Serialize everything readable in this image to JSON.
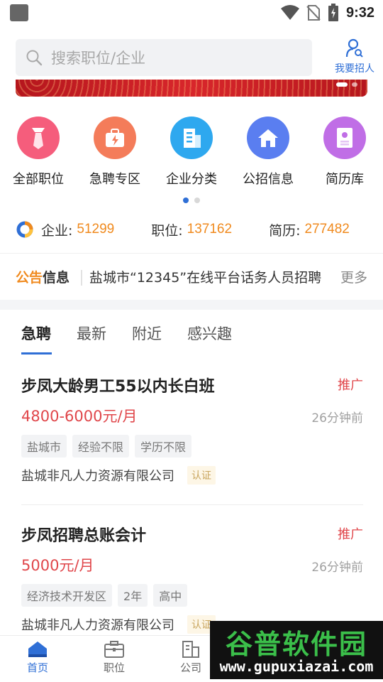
{
  "status_bar": {
    "time": "9:32"
  },
  "header": {
    "search_placeholder": "搜索职位/企业",
    "recruit_label": "我要招人"
  },
  "categories": [
    {
      "label": "全部职位",
      "icon": "tie-icon",
      "color": "#f55d7c"
    },
    {
      "label": "急聘专区",
      "icon": "urgent-bag-icon",
      "color": "#f47c5a"
    },
    {
      "label": "企业分类",
      "icon": "building-icon",
      "color": "#2ea8ef"
    },
    {
      "label": "公招信息",
      "icon": "home-icon",
      "color": "#5a7ef0"
    },
    {
      "label": "简历库",
      "icon": "resume-icon",
      "color": "#c06ee6"
    }
  ],
  "stats": {
    "company_label": "企业:",
    "company_count": "51299",
    "position_label": "职位:",
    "position_count": "137162",
    "resume_label": "简历:",
    "resume_count": "277482"
  },
  "notice": {
    "logo_a": "公告",
    "logo_b": "信息",
    "text": "盐城市“12345”在线平台话务人员招聘",
    "more": "更多"
  },
  "tabs": [
    "急聘",
    "最新",
    "附近",
    "感兴趣"
  ],
  "jobs": [
    {
      "title": "步凤大龄男工55以内长白班",
      "promo": "推广",
      "salary": "4800-6000元/月",
      "time": "26分钟前",
      "tags": [
        "盐城市",
        "经验不限",
        "学历不限"
      ],
      "company": "盐城非凡人力资源有限公司",
      "cert": "认证"
    },
    {
      "title": "步凤招聘总账会计",
      "promo": "推广",
      "salary": "5000元/月",
      "time": "26分钟前",
      "tags": [
        "经济技术开发区",
        "2年",
        "高中"
      ],
      "company": "盐城非凡人力资源有限公司",
      "cert": "认证"
    }
  ],
  "bottom_nav": [
    {
      "label": "首页",
      "icon": "home-icon",
      "active": true
    },
    {
      "label": "职位",
      "icon": "briefcase-icon",
      "active": false
    },
    {
      "label": "公司",
      "icon": "building-icon",
      "active": false
    }
  ],
  "watermark": {
    "top": "谷普软件园",
    "bottom": "www.gupuxiazai.com"
  },
  "colors": {
    "accent": "#2f6fd6",
    "salary": "#e0464a",
    "count": "#f08a1e"
  }
}
